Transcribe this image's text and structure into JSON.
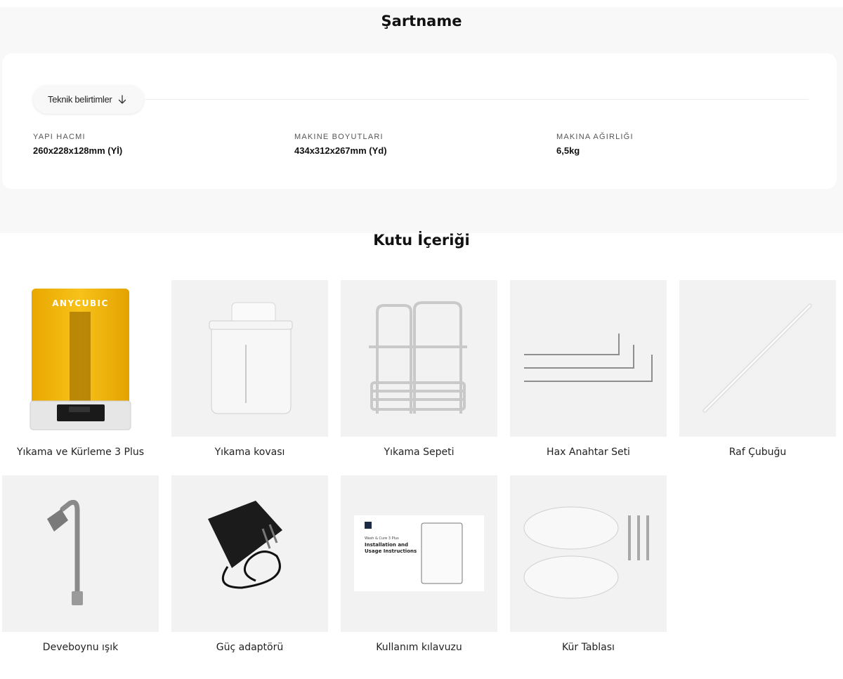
{
  "spec": {
    "title": "Şartname",
    "tab_label": "Teknik belirtimler",
    "items": [
      {
        "label": "YAPI HACMI",
        "value": "260x228x128mm (Yİ)"
      },
      {
        "label": "MAKINE BOYUTLARI",
        "value": "434x312x267mm (Yd)"
      },
      {
        "label": "MAKINA AĞIRLIĞI",
        "value": "6,5kg"
      }
    ]
  },
  "box": {
    "title": "Kutu İçeriği",
    "items": [
      {
        "caption": "Yıkama ve Kürleme 3 Plus",
        "icon": "wash-cure-machine-image"
      },
      {
        "caption": "Yıkama kovası",
        "icon": "wash-bucket-image"
      },
      {
        "caption": "Yıkama Sepeti",
        "icon": "wash-basket-image"
      },
      {
        "caption": "Hax Anahtar Seti",
        "icon": "hex-key-set-image"
      },
      {
        "caption": "Raf Çubuğu",
        "icon": "shelf-rod-image"
      },
      {
        "caption": "Deveboynu ışık",
        "icon": "gooseneck-light-image"
      },
      {
        "caption": "Güç adaptörü",
        "icon": "power-adapter-image"
      },
      {
        "caption": "Kullanım kılavuzu",
        "icon": "user-manual-image"
      },
      {
        "caption": "Kür Tablası",
        "icon": "curing-turntable-image"
      }
    ],
    "brand_text": "ANYCUBIC",
    "manual_text": {
      "line1": "Installation and",
      "line2": "Usage Instructions",
      "product": "Wash & Cure 3 Plus"
    }
  },
  "colors": {
    "machine_yellow": "#f2b705",
    "section_bg": "#f8f8f8",
    "tile_bg": "#f2f2f2"
  }
}
